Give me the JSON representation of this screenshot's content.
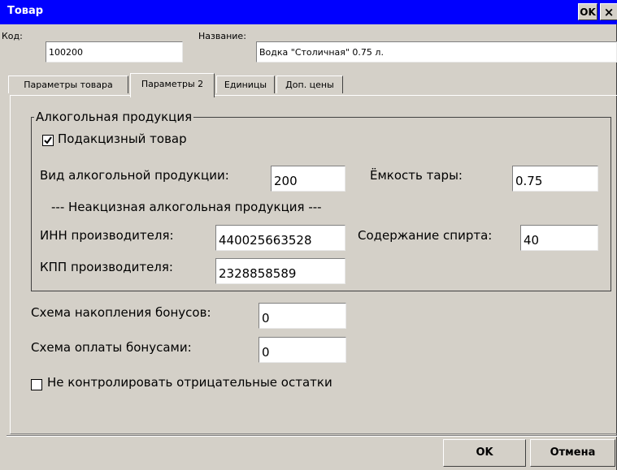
{
  "window": {
    "title": "Товар",
    "ok_label": "OK",
    "close_label": "×"
  },
  "header": {
    "code_label": "Код:",
    "code_value": "100200",
    "name_label": "Название:",
    "name_value": "Водка \"Столичная\" 0.75 л."
  },
  "tabs": [
    {
      "label": "Параметры товара",
      "active": false
    },
    {
      "label": "Параметры 2",
      "active": true
    },
    {
      "label": "Единицы",
      "active": false
    },
    {
      "label": "Доп. цены",
      "active": false
    }
  ],
  "alcohol": {
    "group_title": "Алкогольная продукция",
    "excise_label": "Подакцизный товар",
    "excise_checked": true,
    "kind_label": "Вид алкогольной продукции:",
    "kind_value": "200",
    "capacity_label": "Ёмкость тары:",
    "capacity_value": "0.75",
    "nonexcise_heading": "--- Неакцизная алкогольная продукция ---",
    "inn_label": "ИНН производителя:",
    "inn_value": "440025663528",
    "alcohol_content_label": "Содержание спирта:",
    "alcohol_content_value": "40",
    "kpp_label": "КПП производителя:",
    "kpp_value": "2328858589"
  },
  "bonus": {
    "accrual_label": "Схема накопления бонусов:",
    "accrual_value": "0",
    "payment_label": "Схема оплаты бонусами:",
    "payment_value": "0"
  },
  "negative_stock": {
    "label": "Не контролировать отрицательные остатки",
    "checked": false
  },
  "footer": {
    "ok_label": "OK",
    "cancel_label": "Отмена"
  },
  "colors": {
    "titlebar": "#0000ff",
    "face": "#d4d0c8"
  }
}
